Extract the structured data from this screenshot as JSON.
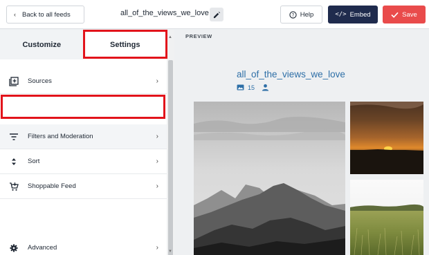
{
  "header": {
    "back_label": "Back to all feeds",
    "feed_title": "all_of_the_views_we_love",
    "help_label": "Help",
    "embed_label": "Embed",
    "save_label": "Save",
    "colors": {
      "embed": "#1f2b4d",
      "save": "#e94b4b"
    }
  },
  "tabs": [
    {
      "label": "Customize",
      "active": false
    },
    {
      "label": "Settings",
      "active": true
    }
  ],
  "menu": [
    {
      "label": "Sources",
      "icon": "sources-icon"
    },
    {
      "label": "Filters and Moderation",
      "icon": "filter-icon",
      "highlighted": true
    },
    {
      "label": "Sort",
      "icon": "sort-icon"
    },
    {
      "label": "Shoppable Feed",
      "icon": "cart-icon"
    },
    {
      "label": "Advanced",
      "icon": "gear-icon"
    }
  ],
  "preview": {
    "section_label": "PREVIEW",
    "feed_title": "all_of_the_views_we_love",
    "photo_count": "15"
  },
  "highlight_color": "#e2131b"
}
